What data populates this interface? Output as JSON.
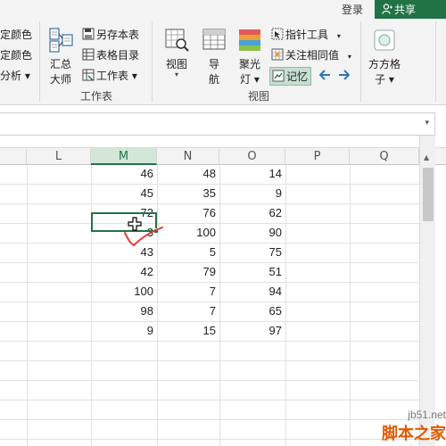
{
  "header": {
    "login_label": "登录",
    "share_label": "共享"
  },
  "ribbon": {
    "left_cut_items": [
      "定颜色",
      "定颜色",
      "分析 ▾"
    ],
    "workbook_group": {
      "summary_button": {
        "line1": "汇总",
        "line2": "大师"
      },
      "commands": [
        "另存本表",
        "表格目录",
        "工作表 ▾"
      ],
      "group_label": "工作表"
    },
    "view_group": {
      "buttons": [
        {
          "label": "视图"
        },
        {
          "label1": "导",
          "label2": "航"
        },
        {
          "label1": "聚光",
          "label2": "灯 ▾"
        }
      ],
      "commands": [
        "指针工具",
        "关注相同值",
        "记忆"
      ],
      "group_label": "视图"
    },
    "fangfang_button": {
      "line1": "方方格",
      "line2": "子 ▾"
    }
  },
  "sheet": {
    "columns": [
      "L",
      "M",
      "N",
      "O",
      "P",
      "Q"
    ],
    "selected_column": "M",
    "rows": [
      {
        "M": "46",
        "N": "48",
        "O": "14"
      },
      {
        "M": "45",
        "N": "35",
        "O": "9"
      },
      {
        "M": "72",
        "N": "76",
        "O": "62"
      },
      {
        "M": "3",
        "N": "100",
        "O": "90"
      },
      {
        "M": "43",
        "N": "5",
        "O": "75"
      },
      {
        "M": "42",
        "N": "79",
        "O": "51"
      },
      {
        "M": "100",
        "N": "7",
        "O": "94"
      },
      {
        "M": "98",
        "N": "7",
        "O": "65"
      },
      {
        "M": "9",
        "N": "15",
        "O": "97"
      }
    ]
  },
  "colors": {
    "accent": "#217346",
    "check_mark": "#e53935",
    "watermark_orange": "#e05a00"
  },
  "watermark": {
    "site": "jb51.net",
    "brand": "脚本之家"
  }
}
